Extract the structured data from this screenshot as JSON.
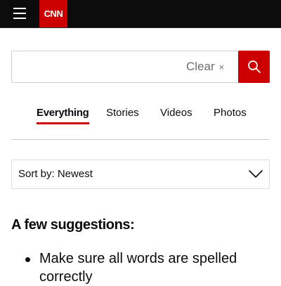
{
  "header": {
    "menu_icon": "hamburger-menu-icon",
    "logo_text": "CNN",
    "colors": {
      "bar": "#0c0c0c",
      "logo": "#cc0000"
    }
  },
  "search": {
    "value": "",
    "placeholder": "",
    "clear_label": "Clear",
    "clear_icon": "×",
    "submit_icon": "search-icon"
  },
  "tabs": [
    {
      "label": "Everything",
      "active": true
    },
    {
      "label": "Stories",
      "active": false
    },
    {
      "label": "Videos",
      "active": false
    },
    {
      "label": "Photos",
      "active": false
    }
  ],
  "sort": {
    "label": "Sort by: Newest",
    "icon": "chevron-down-icon"
  },
  "suggestions": {
    "title": "A few suggestions:",
    "items": [
      "Make sure all words are spelled correctly"
    ]
  },
  "accent_color": "#cc0000"
}
